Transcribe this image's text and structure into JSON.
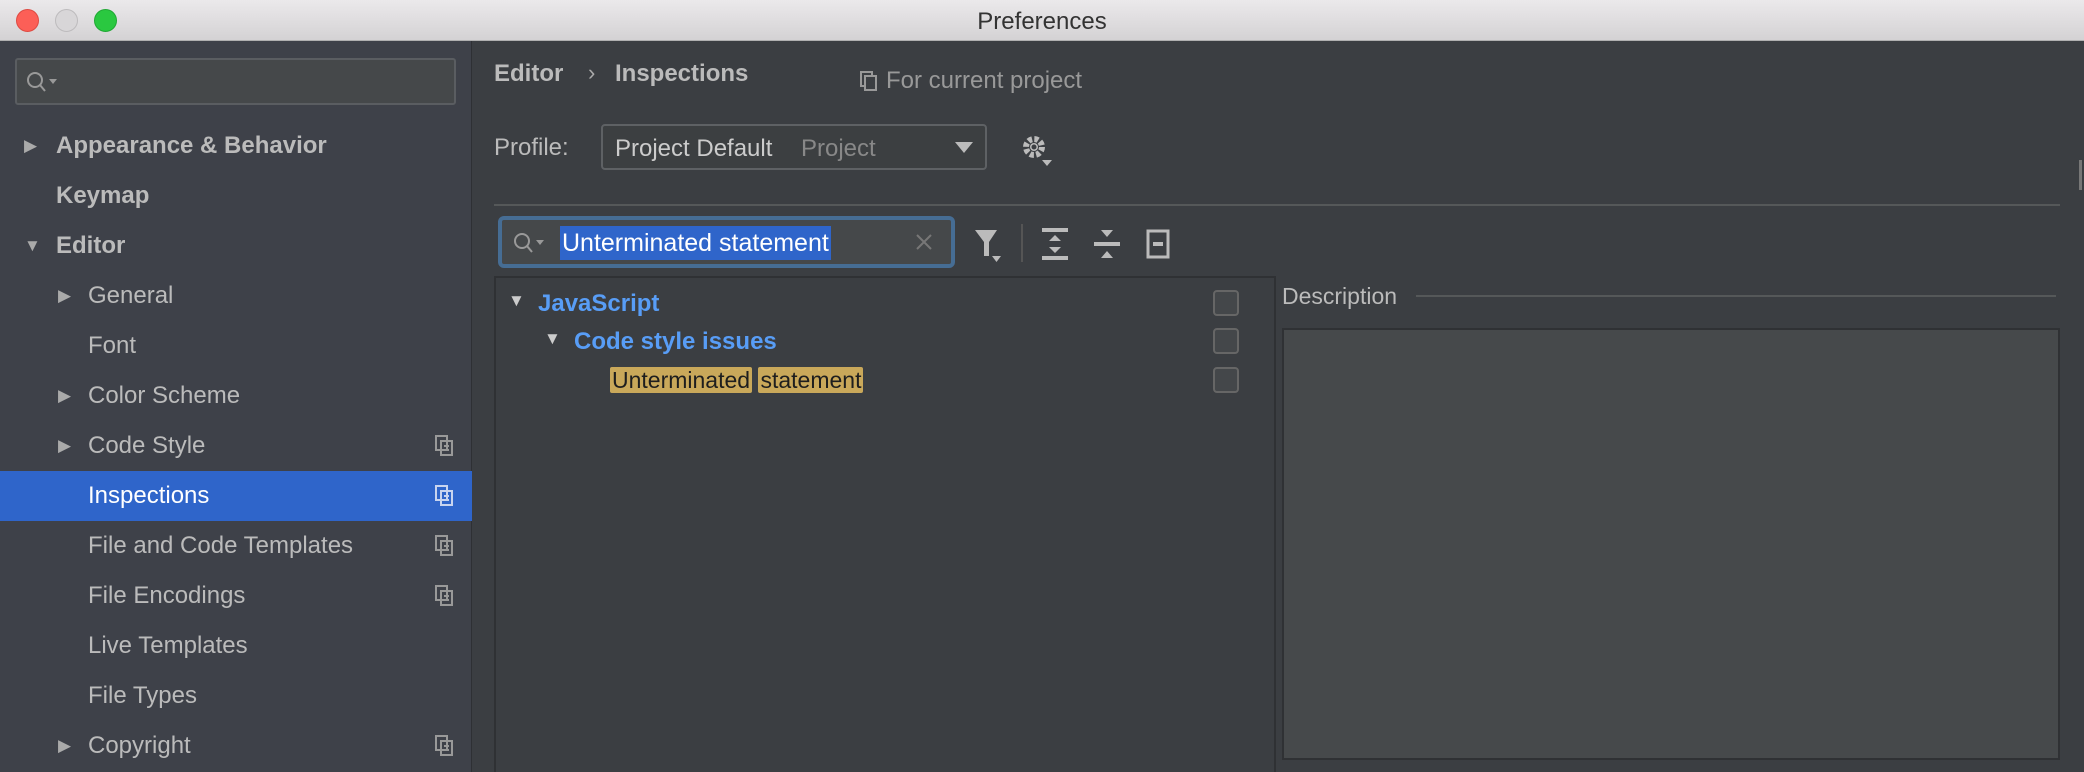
{
  "window": {
    "title": "Preferences"
  },
  "sidebar": {
    "search_placeholder": "",
    "items": [
      {
        "label": "Appearance & Behavior",
        "level": 0,
        "expandable": true,
        "expanded": false,
        "project_icon": false
      },
      {
        "label": "Keymap",
        "level": 0,
        "expandable": false,
        "project_icon": false
      },
      {
        "label": "Editor",
        "level": 0,
        "expandable": true,
        "expanded": true,
        "project_icon": false
      },
      {
        "label": "General",
        "level": 1,
        "expandable": true,
        "expanded": false,
        "project_icon": false
      },
      {
        "label": "Font",
        "level": 1,
        "expandable": false,
        "project_icon": false
      },
      {
        "label": "Color Scheme",
        "level": 1,
        "expandable": true,
        "expanded": false,
        "project_icon": false
      },
      {
        "label": "Code Style",
        "level": 1,
        "expandable": true,
        "expanded": false,
        "project_icon": true
      },
      {
        "label": "Inspections",
        "level": 1,
        "expandable": false,
        "project_icon": true,
        "selected": true
      },
      {
        "label": "File and Code Templates",
        "level": 1,
        "expandable": false,
        "project_icon": true
      },
      {
        "label": "File Encodings",
        "level": 1,
        "expandable": false,
        "project_icon": true
      },
      {
        "label": "Live Templates",
        "level": 1,
        "expandable": false,
        "project_icon": false
      },
      {
        "label": "File Types",
        "level": 1,
        "expandable": false,
        "project_icon": false
      },
      {
        "label": "Copyright",
        "level": 1,
        "expandable": true,
        "expanded": false,
        "project_icon": true
      }
    ]
  },
  "breadcrumb": {
    "parent": "Editor",
    "separator": "›",
    "current": "Inspections",
    "scope": "For current project"
  },
  "profile": {
    "label": "Profile:",
    "value": "Project Default",
    "scope": "Project"
  },
  "filter": {
    "value": "Unterminated statement"
  },
  "tree": {
    "rows": [
      {
        "label": "JavaScript",
        "level": 0,
        "checked": false
      },
      {
        "label": "Code style issues",
        "level": 1,
        "checked": false
      },
      {
        "words": [
          "Unterminated",
          "statement"
        ],
        "level": 2,
        "checked": false
      }
    ]
  },
  "description": {
    "label": "Description"
  },
  "colors": {
    "selection": "#2f65ca",
    "tree_group": "#589df6",
    "match_highlight": "#c9a85a"
  }
}
